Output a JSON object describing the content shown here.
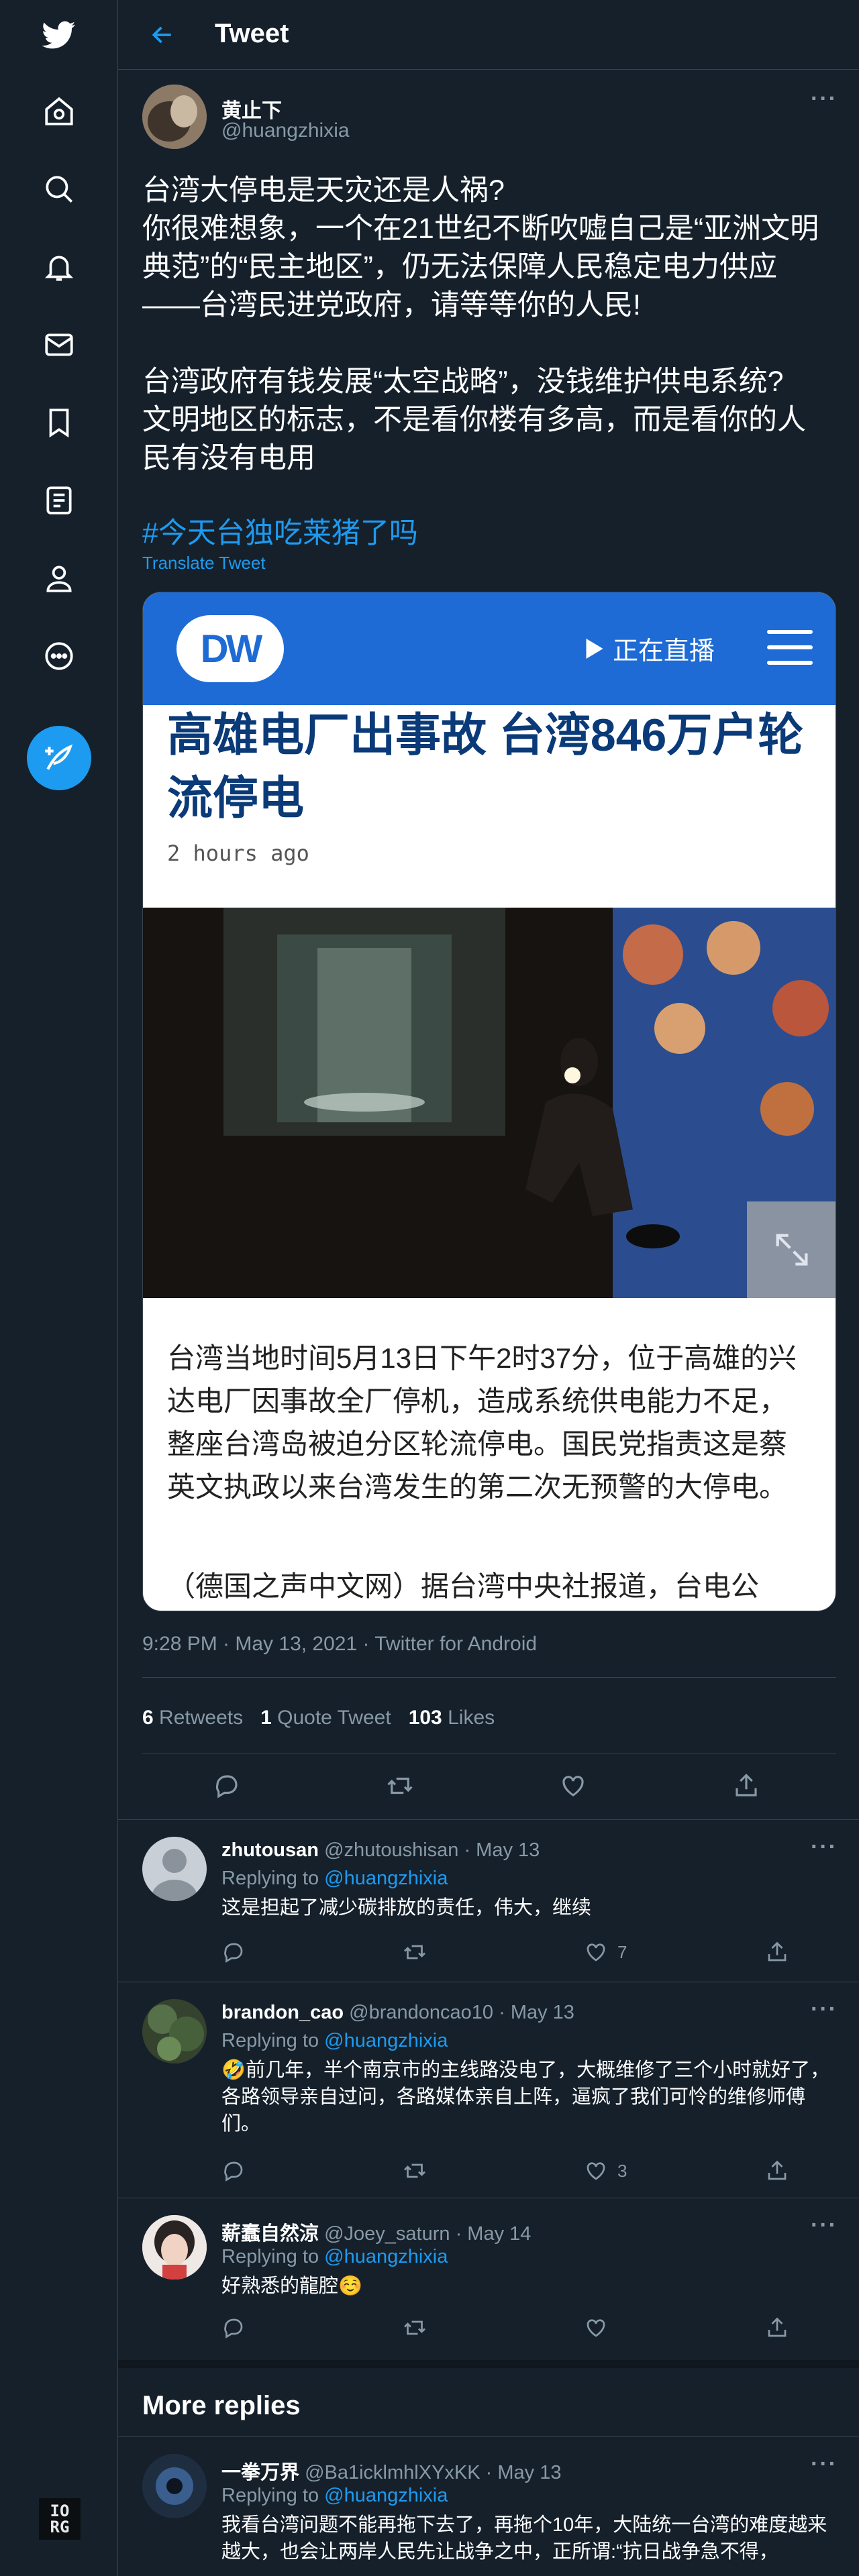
{
  "header": {
    "title": "Tweet"
  },
  "author": {
    "name": "黄止下",
    "handle": "@huangzhixia"
  },
  "tweet": {
    "text": "台湾大停电是天灾还是人祸?\n你很难想象，一个在21世纪不断吹嘘自己是“亚洲文明典范”的“民主地区”，仍无法保障人民稳定电力供应——台湾民进党政府，请等等你的人民!\n\n台湾政府有钱发展“太空战略”，没钱维护供电系统?\n文明地区的标志，不是看你楼有多高，而是看你的人民有没有电用",
    "hashtag": "#今天台独吃莱猪了吗",
    "translate_label": "Translate Tweet",
    "meta": "9:28 PM · May 13, 2021 · Twitter for Android"
  },
  "card": {
    "logo": "DW",
    "live_label": "正在直播",
    "headline": "高雄电厂出事故 台湾846万户轮流停电",
    "time": "2 hours ago",
    "body": "台湾当地时间5月13日下午2时37分，位于高雄的兴达电厂因事故全厂停机，造成系统供电能力不足，整座台湾岛被迫分区轮流停电。国民党指责这是蔡英文执政以来台湾发生的第二次无预警的大停电。",
    "body2": "（德国之声中文网）据台湾中央社报道，台电公"
  },
  "stats": {
    "retweets_count": "6",
    "retweets_label": "Retweets",
    "quotes_count": "1",
    "quotes_label": "Quote Tweet",
    "likes_count": "103",
    "likes_label": "Likes"
  },
  "replies": [
    {
      "name": "zhutousan",
      "handle": "@zhutoushisan",
      "date": "· May 13",
      "replying_label": "Replying to",
      "replying_to": "@huangzhixia",
      "text": "这是担起了减少碳排放的责任，伟大，继续",
      "likes": "7"
    },
    {
      "name": "brandon_cao",
      "handle": "@brandoncao10",
      "date": "· May 13",
      "replying_label": "Replying to",
      "replying_to": "@huangzhixia",
      "text": "🤣前几年，半个南京市的主线路没电了，大概维修了三个小时就好了，各路领导亲自过问，各路媒体亲自上阵，逼疯了我们可怜的维修师傅们。",
      "likes": "3"
    },
    {
      "name": "薪蠢自然涼",
      "handle": "@Joey_saturn",
      "date": "· May 14",
      "replying_label": "Replying to",
      "replying_to": "@huangzhixia",
      "text": "好熟悉的龍腔☺️",
      "likes": ""
    }
  ],
  "more_replies": {
    "title": "More replies",
    "items": [
      {
        "name": "一拳万界",
        "handle": "@Ba1icklmhlXYxKK",
        "date": "· May 13",
        "replying_label": "Replying to",
        "replying_to": "@huangzhixia",
        "text": "我看台湾问题不能再拖下去了，再拖个10年，大陆统一台湾的难度越来越大，也会让两岸人民先让战争之中，正所谓:“抗日战争急不得，"
      }
    ]
  },
  "footer_badge": {
    "line1": "IO",
    "line2": "RG"
  },
  "colors": {
    "background": "#15202b",
    "accent": "#1d9bf0",
    "muted": "#8899a6",
    "border": "#38444d",
    "dw_blue": "#1e6bd6"
  }
}
